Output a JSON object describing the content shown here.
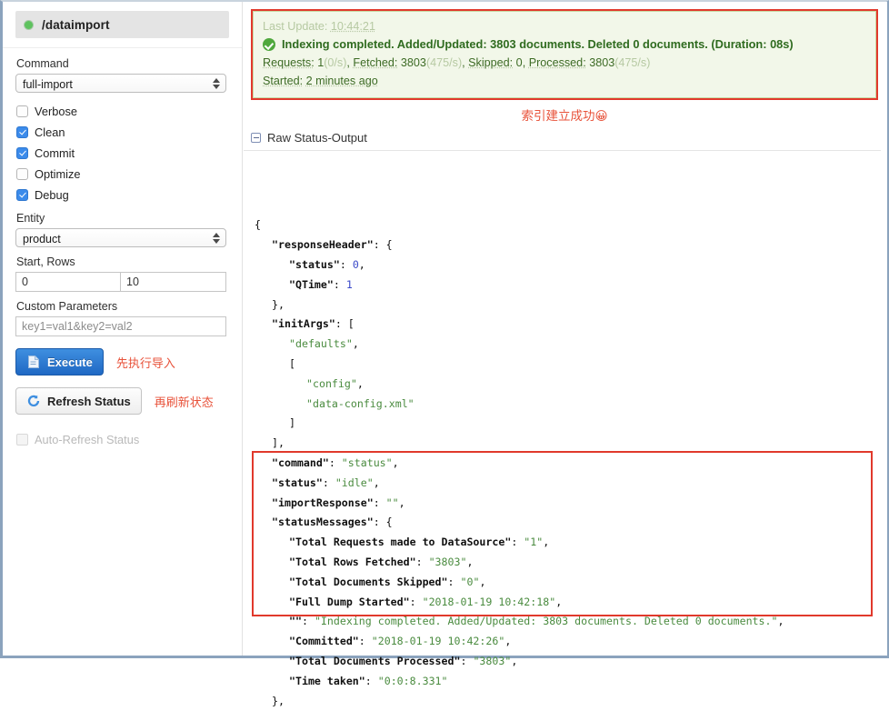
{
  "sidebar": {
    "handler": {
      "name": "/dataimport",
      "status_icon": "green-status-dot"
    },
    "command": {
      "label": "Command",
      "value": "full-import"
    },
    "checkboxes": [
      {
        "label": "Verbose",
        "checked": false
      },
      {
        "label": "Clean",
        "checked": true
      },
      {
        "label": "Commit",
        "checked": true
      },
      {
        "label": "Optimize",
        "checked": false
      },
      {
        "label": "Debug",
        "checked": true
      }
    ],
    "entity": {
      "label": "Entity",
      "value": "product"
    },
    "start_rows": {
      "label": "Start, Rows",
      "start": "0",
      "rows": "10"
    },
    "custom_parameters": {
      "label": "Custom Parameters",
      "placeholder": "key1=val1&key2=val2"
    },
    "execute": {
      "label": "Execute",
      "note": "先执行导入",
      "icon": "execute-document-icon"
    },
    "refresh": {
      "label": "Refresh Status",
      "note": "再刷新状态",
      "icon": "refresh-circle-icon"
    },
    "auto_refresh": {
      "label": "Auto-Refresh Status",
      "checked": false
    }
  },
  "status": {
    "last_update_label": "Last Update:",
    "last_update_value": "10:44:21",
    "message": "Indexing completed. Added/Updated: 3803 documents. Deleted 0 documents. (Duration: 08s)",
    "requests_label": "Requests:",
    "requests_value": "1",
    "requests_rate": "(0/s)",
    "fetched_label": "Fetched:",
    "fetched_value": "3803",
    "fetched_rate": "(475/s)",
    "skipped_label": "Skipped:",
    "skipped_value": "0",
    "processed_label": "Processed:",
    "processed_value": "3803",
    "processed_rate": "(475/s)",
    "started_label": "Started:",
    "started_value": "2 minutes ago"
  },
  "annotation": "索引建立成功😀",
  "raw_output": {
    "title": "Raw Status-Output",
    "toggle_icon": "minus-square-icon"
  },
  "json_lines": [
    {
      "indent": 0,
      "parts": [
        {
          "t": "{",
          "c": "p"
        }
      ]
    },
    {
      "indent": 1,
      "parts": [
        {
          "t": "\"responseHeader\"",
          "c": "k"
        },
        {
          "t": ": {",
          "c": "p"
        }
      ]
    },
    {
      "indent": 2,
      "parts": [
        {
          "t": "\"status\"",
          "c": "k"
        },
        {
          "t": ": ",
          "c": "p"
        },
        {
          "t": "0",
          "c": "n"
        },
        {
          "t": ",",
          "c": "p"
        }
      ]
    },
    {
      "indent": 2,
      "parts": [
        {
          "t": "\"QTime\"",
          "c": "k"
        },
        {
          "t": ": ",
          "c": "p"
        },
        {
          "t": "1",
          "c": "n"
        }
      ]
    },
    {
      "indent": 1,
      "parts": [
        {
          "t": "},",
          "c": "p"
        }
      ]
    },
    {
      "indent": 1,
      "parts": [
        {
          "t": "\"initArgs\"",
          "c": "k"
        },
        {
          "t": ": [",
          "c": "p"
        }
      ]
    },
    {
      "indent": 2,
      "parts": [
        {
          "t": "\"defaults\"",
          "c": "s"
        },
        {
          "t": ",",
          "c": "p"
        }
      ]
    },
    {
      "indent": 2,
      "parts": [
        {
          "t": "[",
          "c": "p"
        }
      ]
    },
    {
      "indent": 3,
      "parts": [
        {
          "t": "\"config\"",
          "c": "s"
        },
        {
          "t": ",",
          "c": "p"
        }
      ]
    },
    {
      "indent": 3,
      "parts": [
        {
          "t": "\"data-config.xml\"",
          "c": "s"
        }
      ]
    },
    {
      "indent": 2,
      "parts": [
        {
          "t": "]",
          "c": "p"
        }
      ]
    },
    {
      "indent": 1,
      "parts": [
        {
          "t": "],",
          "c": "p"
        }
      ]
    },
    {
      "indent": 1,
      "parts": [
        {
          "t": "\"command\"",
          "c": "k"
        },
        {
          "t": ": ",
          "c": "p"
        },
        {
          "t": "\"status\"",
          "c": "s"
        },
        {
          "t": ",",
          "c": "p"
        }
      ]
    },
    {
      "indent": 1,
      "parts": [
        {
          "t": "\"status\"",
          "c": "k"
        },
        {
          "t": ": ",
          "c": "p"
        },
        {
          "t": "\"idle\"",
          "c": "s"
        },
        {
          "t": ",",
          "c": "p"
        }
      ]
    },
    {
      "indent": 1,
      "parts": [
        {
          "t": "\"importResponse\"",
          "c": "k"
        },
        {
          "t": ": ",
          "c": "p"
        },
        {
          "t": "\"\"",
          "c": "s"
        },
        {
          "t": ",",
          "c": "p"
        }
      ]
    },
    {
      "indent": 1,
      "parts": [
        {
          "t": "\"statusMessages\"",
          "c": "k"
        },
        {
          "t": ": {",
          "c": "p"
        }
      ]
    },
    {
      "indent": 2,
      "parts": [
        {
          "t": "\"Total Requests made to DataSource\"",
          "c": "k"
        },
        {
          "t": ": ",
          "c": "p"
        },
        {
          "t": "\"1\"",
          "c": "s"
        },
        {
          "t": ",",
          "c": "p"
        }
      ]
    },
    {
      "indent": 2,
      "parts": [
        {
          "t": "\"Total Rows Fetched\"",
          "c": "k"
        },
        {
          "t": ": ",
          "c": "p"
        },
        {
          "t": "\"3803\"",
          "c": "s"
        },
        {
          "t": ",",
          "c": "p"
        }
      ]
    },
    {
      "indent": 2,
      "parts": [
        {
          "t": "\"Total Documents Skipped\"",
          "c": "k"
        },
        {
          "t": ": ",
          "c": "p"
        },
        {
          "t": "\"0\"",
          "c": "s"
        },
        {
          "t": ",",
          "c": "p"
        }
      ]
    },
    {
      "indent": 2,
      "parts": [
        {
          "t": "\"Full Dump Started\"",
          "c": "k"
        },
        {
          "t": ": ",
          "c": "p"
        },
        {
          "t": "\"2018-01-19 10:42:18\"",
          "c": "s"
        },
        {
          "t": ",",
          "c": "p"
        }
      ]
    },
    {
      "indent": 2,
      "parts": [
        {
          "t": "\"\"",
          "c": "k"
        },
        {
          "t": ": ",
          "c": "p"
        },
        {
          "t": "\"Indexing completed. Added/Updated: 3803 documents. Deleted 0 documents.\"",
          "c": "s"
        },
        {
          "t": ",",
          "c": "p"
        }
      ]
    },
    {
      "indent": 2,
      "parts": [
        {
          "t": "\"Committed\"",
          "c": "k"
        },
        {
          "t": ": ",
          "c": "p"
        },
        {
          "t": "\"2018-01-19 10:42:26\"",
          "c": "s"
        },
        {
          "t": ",",
          "c": "p"
        }
      ]
    },
    {
      "indent": 2,
      "parts": [
        {
          "t": "\"Total Documents Processed\"",
          "c": "k"
        },
        {
          "t": ": ",
          "c": "p"
        },
        {
          "t": "\"3803\"",
          "c": "s"
        },
        {
          "t": ",",
          "c": "p"
        }
      ]
    },
    {
      "indent": 2,
      "parts": [
        {
          "t": "\"Time taken\"",
          "c": "k"
        },
        {
          "t": ": ",
          "c": "p"
        },
        {
          "t": "\"0:0:8.331\"",
          "c": "s"
        }
      ]
    },
    {
      "indent": 1,
      "parts": [
        {
          "t": "},",
          "c": "p"
        }
      ]
    }
  ],
  "colors": {
    "accent_red": "#e1392c",
    "note_red": "#e8523a",
    "success_green": "#4fa83d",
    "primary_blue": "#2f78d0",
    "status_bg": "#f2f7e9"
  }
}
